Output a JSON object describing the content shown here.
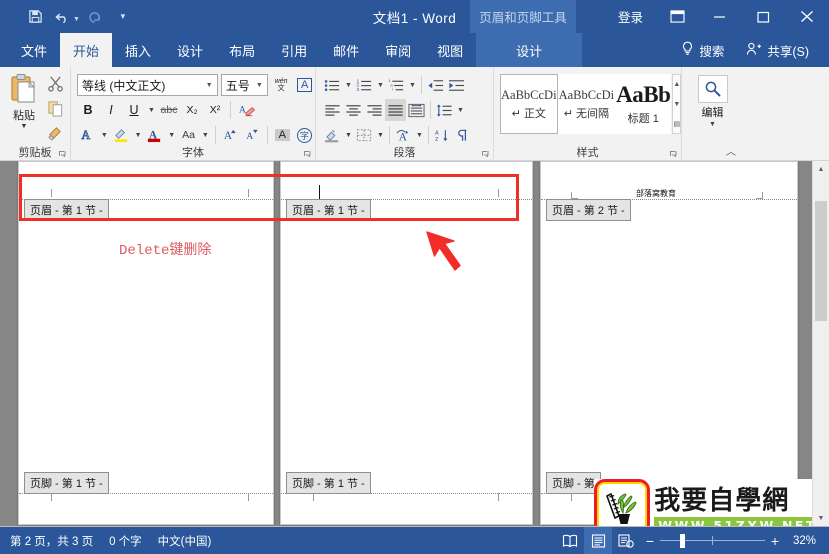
{
  "titlebar": {
    "document_title": "文档1  -  Word",
    "contextual_tool": "页眉和页脚工具",
    "signin": "登录",
    "qat": {
      "save": "save-icon",
      "undo": "undo-icon",
      "redo": "redo-icon",
      "customize": "customize-icon"
    },
    "ribbon_display_options": "ribbon-options-icon",
    "minimize": "minimize-icon",
    "maximize": "maximize-icon",
    "close": "close-icon"
  },
  "tabs": [
    {
      "label": "文件",
      "active": false
    },
    {
      "label": "开始",
      "active": true
    },
    {
      "label": "插入",
      "active": false
    },
    {
      "label": "设计",
      "active": false
    },
    {
      "label": "布局",
      "active": false
    },
    {
      "label": "引用",
      "active": false
    },
    {
      "label": "邮件",
      "active": false
    },
    {
      "label": "审阅",
      "active": false
    },
    {
      "label": "视图",
      "active": false
    }
  ],
  "contextual_tab": {
    "label": "设计"
  },
  "search": {
    "label": "搜索",
    "icon": "lightbulb-icon"
  },
  "share": {
    "label": "共享(S)",
    "icon": "person-add-icon"
  },
  "ribbon": {
    "groups": [
      {
        "name": "剪贴板"
      },
      {
        "name": "字体"
      },
      {
        "name": "段落"
      },
      {
        "name": "样式"
      }
    ],
    "clipboard": {
      "paste_label": "粘贴",
      "cut": "scissors-icon",
      "copy": "copy-icon",
      "format_painter": "format-painter-icon"
    },
    "font": {
      "font_name": "等线 (中文正文)",
      "font_size": "五号",
      "phonetic_guide": "wén",
      "character_border": "A",
      "bold": "B",
      "italic": "I",
      "underline": "U",
      "strikethrough": "abc",
      "subscript": "X₂",
      "superscript": "X²",
      "clear_formatting": "clear-format-icon",
      "text_effects": "A",
      "highlight": "highlight-icon",
      "font_color": "font-color-icon",
      "change_case": "Aa",
      "grow_font": "A",
      "shrink_font": "A",
      "char_shading": "A",
      "enclose_char": "字"
    },
    "paragraph": {
      "bullets": "bullet-list-icon",
      "numbering": "numbered-list-icon",
      "multilevel": "multilevel-list-icon",
      "decrease_indent": "decrease-indent-icon",
      "increase_indent": "increase-indent-icon",
      "align_left": "align-left-icon",
      "align_center": "align-center-icon",
      "align_right": "align-right-icon",
      "justify": "justify-icon",
      "distribute": "distribute-icon",
      "line_spacing": "line-spacing-icon",
      "shading": "shading-icon",
      "borders": "borders-icon",
      "asian_layout": "asian-layout-icon",
      "sort": "sort-icon",
      "show_marks": "show-marks-icon"
    },
    "styles": [
      {
        "sample": "AaBbCcDi",
        "name": "正文",
        "current": true
      },
      {
        "sample": "AaBbCcDi",
        "name": "无间隔",
        "current": false
      },
      {
        "sample": "AaBb",
        "name": "标题 1",
        "current": false
      }
    ],
    "editing": {
      "label": "编辑",
      "icon": "search-icon"
    },
    "collapse_ribbon": "collapse-ribbon-icon"
  },
  "document": {
    "pages": [
      {
        "id": "page-1",
        "header_tag": "页眉 - 第 1 节 -",
        "footer_tag": "页脚 - 第 1 节 -",
        "header_text": "",
        "selected": true
      },
      {
        "id": "page-2",
        "header_tag": "页眉 - 第 1 节 -",
        "footer_tag": "页脚 - 第 1 节 -",
        "header_text": "",
        "selected": true,
        "has_cursor": true
      },
      {
        "id": "page-3",
        "header_tag": "页眉 - 第 2 节 -",
        "footer_tag": "页脚 - 第",
        "header_text": "部落窝教育",
        "selected": false
      }
    ],
    "annotation_text": "Delete键删除",
    "annotation_color": "#e05a5f",
    "selection_color": "#ee3124",
    "arrow": "red-arrow-pointer"
  },
  "watermark": {
    "brand_cn": "我要自學網",
    "url": "WWW.51ZXW.NET",
    "badge": "plant-logo-icon"
  },
  "statusbar": {
    "page_info": "第 2 页，共 3 页",
    "word_count": "0 个字",
    "language": "中文(中国)",
    "views": [
      {
        "name": "read-mode",
        "icon": "read-mode-icon",
        "selected": false
      },
      {
        "name": "print-layout",
        "icon": "print-layout-icon",
        "selected": true
      },
      {
        "name": "web-layout",
        "icon": "web-layout-icon",
        "selected": false
      }
    ],
    "zoom_out": "−",
    "zoom_in": "+",
    "zoom_value": "32%"
  }
}
